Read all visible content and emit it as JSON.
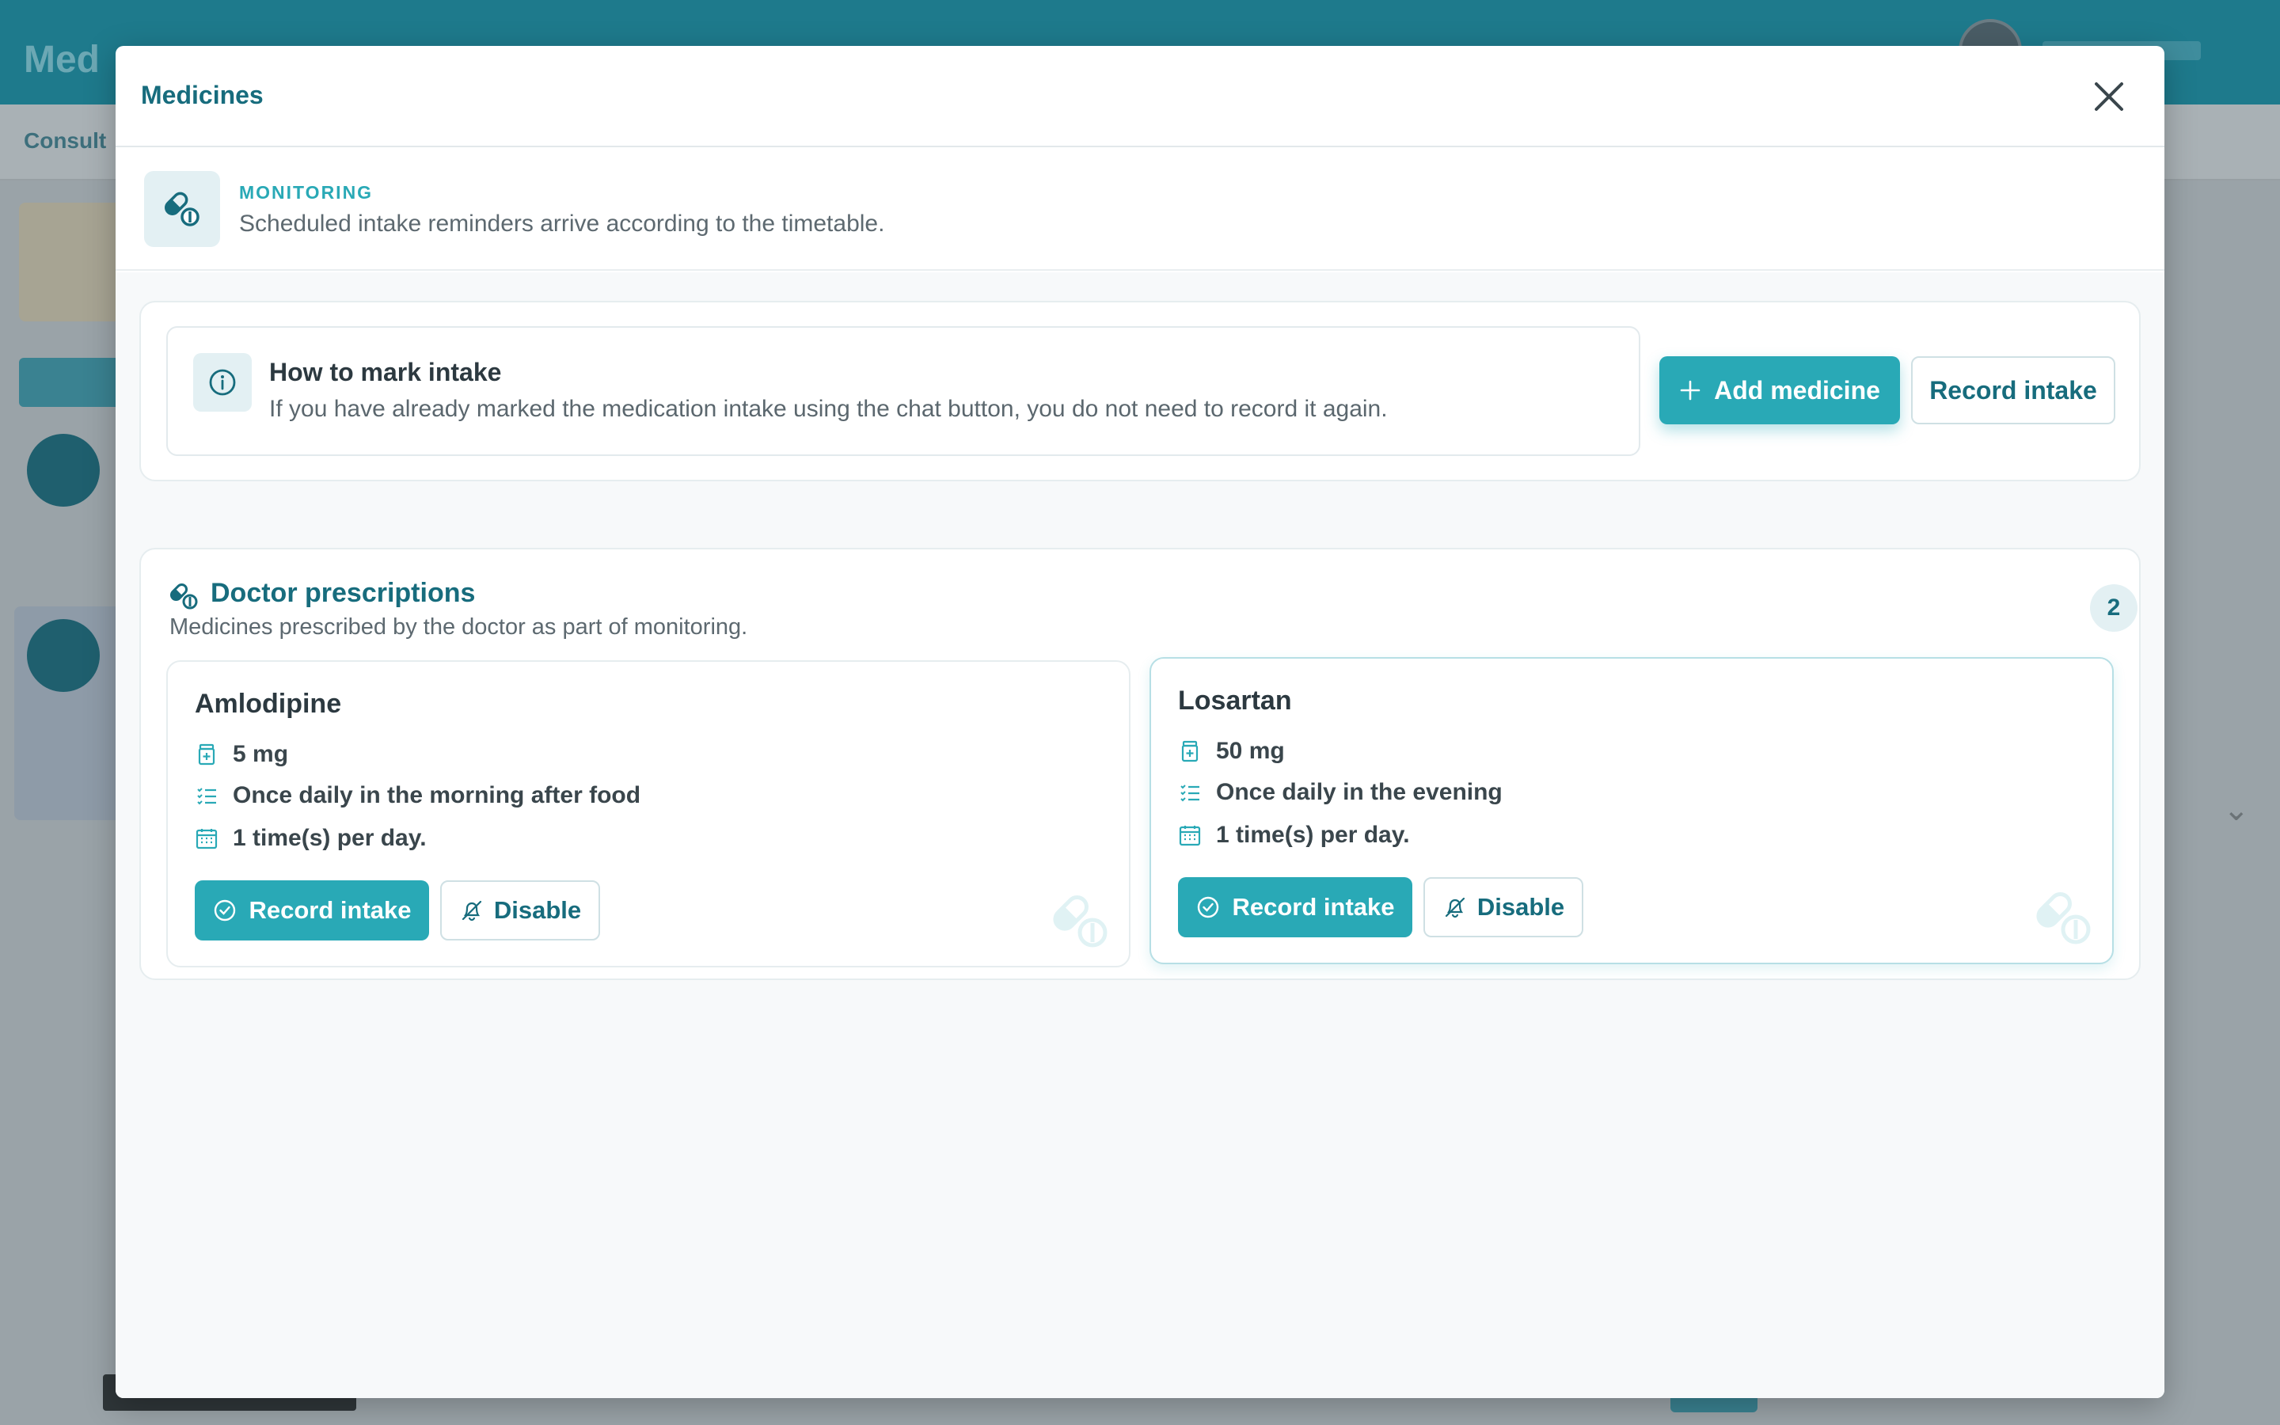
{
  "background": {
    "logo": "Med",
    "subnav": "Consult"
  },
  "modal": {
    "title": "Medicines",
    "monitoring": {
      "label": "MONITORING",
      "description": "Scheduled intake reminders arrive according to the timetable."
    },
    "howto": {
      "title": "How to mark intake",
      "text": "If you have already marked the medication intake using the chat button, you do not need to record it again.",
      "add_label": "Add medicine",
      "record_label": "Record intake"
    },
    "prescriptions": {
      "title": "Doctor prescriptions",
      "subtitle": "Medicines prescribed by the doctor as part of monitoring.",
      "count": "2",
      "items": [
        {
          "name": "Amlodipine",
          "dose": "5 mg",
          "instructions": "Once daily in the morning after food",
          "frequency": "1 time(s) per day.",
          "record_label": "Record intake",
          "disable_label": "Disable"
        },
        {
          "name": "Losartan",
          "dose": "50 mg",
          "instructions": "Once daily in the evening",
          "frequency": "1 time(s) per day.",
          "record_label": "Record intake",
          "disable_label": "Disable"
        }
      ]
    }
  },
  "colors": {
    "accent": "#29a9b6",
    "primary_dark": "#176c7d",
    "text": "#2c3940",
    "muted": "#5d6970"
  },
  "icons": [
    "close-icon",
    "pill-icon",
    "info-icon",
    "plus-icon",
    "dose-bottle-icon",
    "list-icon",
    "calendar-icon",
    "check-circle-icon",
    "bell-off-icon"
  ]
}
